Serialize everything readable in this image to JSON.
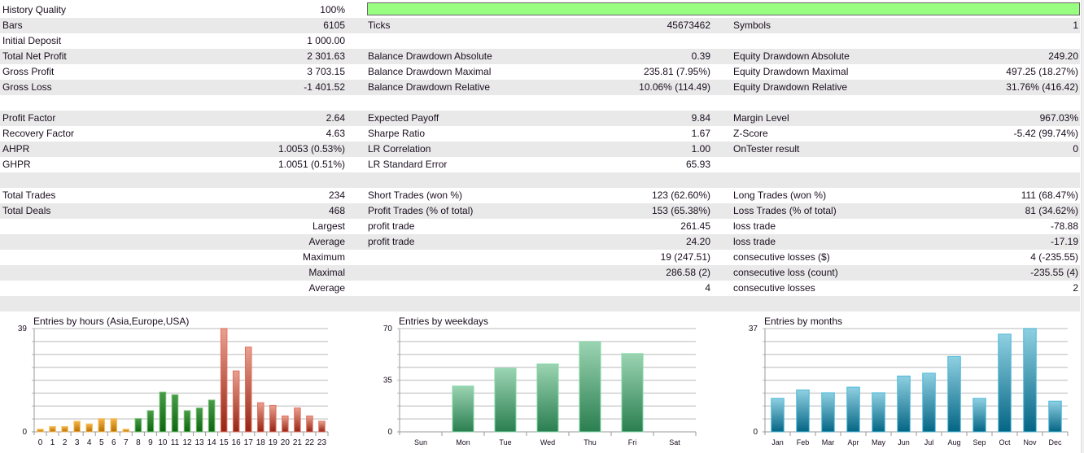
{
  "stats": {
    "history_quality": {
      "label": "History Quality",
      "value": "100%",
      "progress_percent": 100
    },
    "rows": [
      {
        "c1": [
          "Bars",
          "6105"
        ],
        "c2": [
          "Ticks",
          "45673462"
        ],
        "c3": [
          "Symbols",
          "1"
        ]
      },
      {
        "c1": [
          "Initial Deposit",
          "1 000.00"
        ],
        "c2": [
          "",
          ""
        ],
        "c3": [
          "",
          ""
        ]
      },
      {
        "c1": [
          "Total Net Profit",
          "2 301.63"
        ],
        "c2": [
          "Balance Drawdown Absolute",
          "0.39"
        ],
        "c3": [
          "Equity Drawdown Absolute",
          "249.20"
        ]
      },
      {
        "c1": [
          "Gross Profit",
          "3 703.15"
        ],
        "c2": [
          "Balance Drawdown Maximal",
          "235.81 (7.95%)"
        ],
        "c3": [
          "Equity Drawdown Maximal",
          "497.25 (18.27%)"
        ]
      },
      {
        "c1": [
          "Gross Loss",
          "-1 401.52"
        ],
        "c2": [
          "Balance Drawdown Relative",
          "10.06% (114.49)"
        ],
        "c3": [
          "Equity Drawdown Relative",
          "31.76% (416.42)"
        ]
      },
      {
        "c1": [
          "",
          ""
        ],
        "c2": [
          "",
          ""
        ],
        "c3": [
          "",
          ""
        ]
      },
      {
        "c1": [
          "Profit Factor",
          "2.64"
        ],
        "c2": [
          "Expected Payoff",
          "9.84"
        ],
        "c3": [
          "Margin Level",
          "967.03%"
        ]
      },
      {
        "c1": [
          "Recovery Factor",
          "4.63"
        ],
        "c2": [
          "Sharpe Ratio",
          "1.67"
        ],
        "c3": [
          "Z-Score",
          "-5.42 (99.74%)"
        ]
      },
      {
        "c1": [
          "AHPR",
          "1.0053 (0.53%)"
        ],
        "c2": [
          "LR Correlation",
          "1.00"
        ],
        "c3": [
          "OnTester result",
          "0"
        ]
      },
      {
        "c1": [
          "GHPR",
          "1.0051 (0.51%)"
        ],
        "c2": [
          "LR Standard Error",
          "65.93"
        ],
        "c3": [
          "",
          ""
        ]
      },
      {
        "c1": [
          "",
          ""
        ],
        "c2": [
          "",
          ""
        ],
        "c3": [
          "",
          ""
        ]
      },
      {
        "c1": [
          "Total Trades",
          "234"
        ],
        "c2": [
          "Short Trades (won %)",
          "123 (62.60%)"
        ],
        "c3": [
          "Long Trades (won %)",
          "111 (68.47%)"
        ]
      },
      {
        "c1": [
          "Total Deals",
          "468"
        ],
        "c2": [
          "Profit Trades (% of total)",
          "153 (65.38%)"
        ],
        "c3": [
          "Loss Trades (% of total)",
          "81 (34.62%)"
        ]
      },
      {
        "c1": [
          "",
          "Largest"
        ],
        "c2": [
          "profit trade",
          "261.45"
        ],
        "c3": [
          "loss trade",
          "-78.88"
        ]
      },
      {
        "c1": [
          "",
          "Average"
        ],
        "c2": [
          "profit trade",
          "24.20"
        ],
        "c3": [
          "loss trade",
          "-17.19"
        ]
      },
      {
        "c1": [
          "",
          "Maximum"
        ],
        "c2": [
          "",
          "19 (247.51)"
        ],
        "c3": [
          "consecutive losses ($)",
          "4 (-235.55)"
        ]
      },
      {
        "c1": [
          "",
          "Maximal"
        ],
        "c2": [
          "",
          "286.58 (2)"
        ],
        "c3": [
          "consecutive loss (count)",
          "-235.55 (4)"
        ]
      },
      {
        "c1": [
          "",
          "Average"
        ],
        "c2": [
          "",
          "4"
        ],
        "c3": [
          "consecutive losses",
          "2"
        ]
      },
      {
        "c1": [
          "",
          ""
        ],
        "c2": [
          "",
          ""
        ],
        "c3": [
          "",
          ""
        ]
      }
    ]
  },
  "chart_data": [
    {
      "type": "bar",
      "title": "Entries by hours (Asia,Europe,USA)",
      "ylim": [
        0,
        39
      ],
      "yticks": [
        "0",
        "39"
      ],
      "categories": [
        "0",
        "1",
        "2",
        "3",
        "4",
        "5",
        "6",
        "7",
        "8",
        "9",
        "10",
        "11",
        "12",
        "13",
        "14",
        "15",
        "16",
        "17",
        "18",
        "19",
        "20",
        "21",
        "22",
        "23"
      ],
      "values": [
        1,
        2,
        2,
        4,
        3,
        5,
        5,
        1,
        5,
        8,
        15,
        14,
        8,
        9,
        12,
        39,
        23,
        32,
        11,
        10,
        6,
        9,
        6,
        4
      ],
      "groups": [
        "asia",
        "asia",
        "asia",
        "asia",
        "asia",
        "asia",
        "asia",
        "asia",
        "europe",
        "europe",
        "europe",
        "europe",
        "europe",
        "europe",
        "europe",
        "usa",
        "usa",
        "usa",
        "usa",
        "usa",
        "usa",
        "usa",
        "usa",
        "usa"
      ],
      "colors": {
        "asia": [
          "#f5b548",
          "#b86f00"
        ],
        "europe": [
          "#4a9a4a",
          "#0f6610"
        ],
        "usa": [
          "#eaa08e",
          "#962414"
        ]
      },
      "borders": {
        "asia": "#f7c060",
        "europe": "#6cc06c",
        "usa": "#e07060"
      }
    },
    {
      "type": "bar",
      "title": "Entries by weekdays",
      "ylim": [
        0,
        70
      ],
      "yticks": [
        "0",
        "35",
        "70"
      ],
      "categories": [
        "Sun",
        "Mon",
        "Tue",
        "Wed",
        "Thu",
        "Fri",
        "Sat"
      ],
      "values": [
        0,
        31,
        43,
        46,
        61,
        53,
        0
      ],
      "colors": {
        "all": [
          "#9bd4b2",
          "#2a7e50"
        ]
      },
      "borders": {
        "all": "#7fd8a4"
      }
    },
    {
      "type": "bar",
      "title": "Entries by months",
      "ylim": [
        0,
        37
      ],
      "yticks": [
        "0",
        "37"
      ],
      "categories": [
        "Jan",
        "Feb",
        "Mar",
        "Apr",
        "May",
        "Jun",
        "Jul",
        "Aug",
        "Sep",
        "Oct",
        "Nov",
        "Dec"
      ],
      "values": [
        12,
        15,
        14,
        16,
        14,
        20,
        21,
        27,
        12,
        35,
        37,
        11
      ],
      "colors": {
        "all": [
          "#8fd0e2",
          "#046584"
        ]
      },
      "borders": {
        "all": "#4ab8d8"
      }
    }
  ]
}
